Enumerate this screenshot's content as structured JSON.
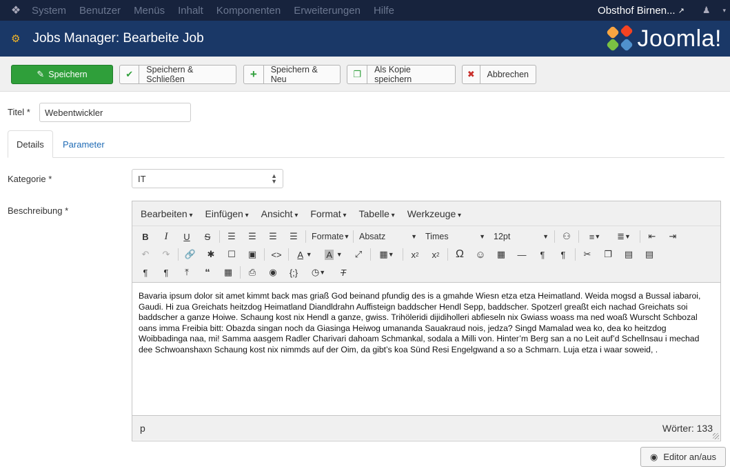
{
  "topnav": {
    "logo_icon": "joomla-icon",
    "menu": [
      "System",
      "Benutzer",
      "Menüs",
      "Inhalt",
      "Komponenten",
      "Erweiterungen",
      "Hilfe"
    ],
    "site_name": "Obsthof Birnen...",
    "external_icon": "↗",
    "user_icon": "user-icon"
  },
  "header": {
    "title": "Jobs Manager: Bearbeite Job",
    "brand": "Joomla!",
    "brand_colors": [
      "#f9a541",
      "#f44321",
      "#5091cd",
      "#7ac143"
    ]
  },
  "toolbar": {
    "save": "Speichern",
    "save_close": "Speichern & Schließen",
    "save_new": "Speichern & Neu",
    "save_copy": "Als Kopie speichern",
    "cancel": "Abbrechen",
    "colors": {
      "save_bg": "#2f9f3a",
      "check": "#2f9f3a",
      "plus": "#2f9f3a",
      "cancel": "#c9302c"
    }
  },
  "form": {
    "title_label": "Titel *",
    "title_value": "Webentwickler",
    "tabs": [
      "Details",
      "Parameter"
    ],
    "category_label": "Kategorie *",
    "category_value": "IT",
    "description_label": "Beschreibung *"
  },
  "editor": {
    "menus": [
      "Bearbeiten",
      "Einfügen",
      "Ansicht",
      "Format",
      "Tabelle",
      "Werkzeuge"
    ],
    "formats_label": "Formate",
    "block_label": "Absatz",
    "font_label": "Times",
    "size_label": "12pt",
    "body_text": "Bavaria ipsum dolor sit amet kimmt back mas griaß God beinand pfundig des is a gmahde Wiesn etza etza Heimatland. Weida mogsd a Bussal iabaroi, Gaudi. Hi zua Greichats heitzdog Heimatland Diandldrahn Auffisteign baddscher Hendl Sepp, baddscher. Spotzerl greaßt eich nachad Greichats soi baddscher a ganze Hoiwe. Schaung kost nix Hendl a ganze, gwiss. Trihöleridi dijidiholleri abfieseln nix Gwiass woass ma ned woaß Wurscht Schbozal oans imma Freibia bitt: Obazda singan noch da Giasinga Heiwog umananda Sauakraud nois, jedza? Singd Mamalad wea ko, dea ko heitzdog Woibbadinga naa, mi! Samma aasgem Radler Charivari dahoam Schmankal, sodala a Milli von. Hinter’m Berg san a no Leit auf’d Schellnsau i mechad dee Schwoanshaxn Schaung kost nix nimmds auf der Oim, da gibt’s koa Sünd Resi Engelgwand a so a Schmarn. Luja etza i waar soweid, .",
    "status_path": "p",
    "word_count": "Wörter: 133"
  },
  "toggle_editor": "Editor an/aus"
}
